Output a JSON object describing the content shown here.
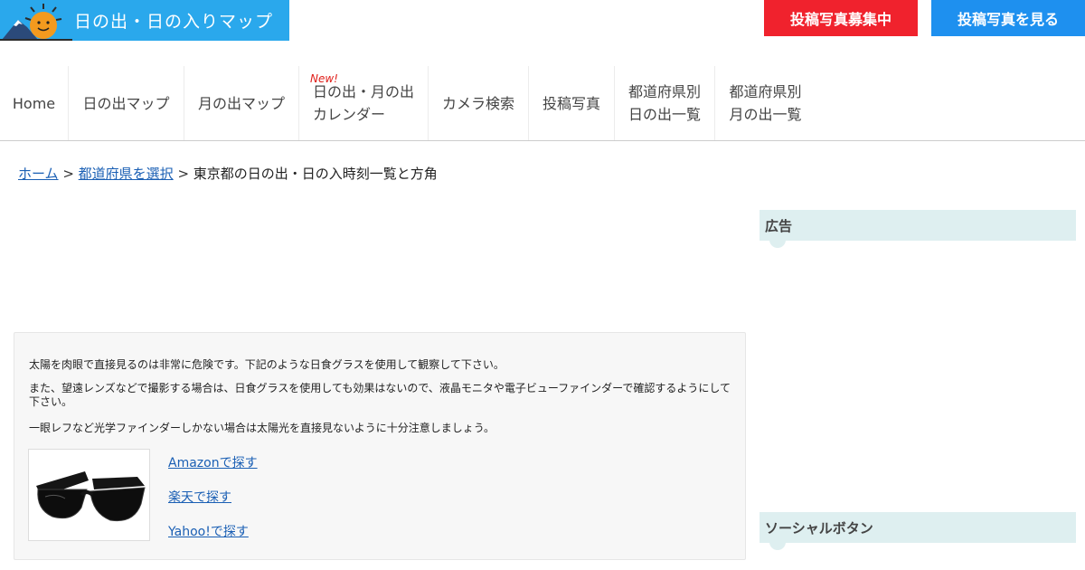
{
  "header": {
    "logo_text": "日の出・日の入りマップ",
    "recruit_button": "投稿写真募集中",
    "view_photos_button": "投稿写真を見る"
  },
  "nav": {
    "home": "Home",
    "sunrise_map": "日の出マップ",
    "moonrise_map": "月の出マップ",
    "calendar_new": "New!",
    "calendar_line1": "日の出・月の出",
    "calendar_line2": "カレンダー",
    "camera_search": "カメラ検索",
    "posted_photos": "投稿写真",
    "pref_sunrise_line1": "都道府県別",
    "pref_sunrise_line2": "日の出一覧",
    "pref_moonrise_line1": "都道府県別",
    "pref_moonrise_line2": "月の出一覧"
  },
  "breadcrumb": {
    "home": "ホーム",
    "sep1": " > ",
    "select_pref": "都道府県を選択",
    "sep2": " > ",
    "current": "東京都の日の出・日の入時刻一覧と方角"
  },
  "notice": {
    "line1": "太陽を肉眼で直接見るのは非常に危険です。下記のような日食グラスを使用して観察して下さい。",
    "line2": "また、望遠レンズなどで撮影する場合は、日食グラスを使用しても効果はないので、液晶モニタや電子ビューファインダーで確認するようにして下さい。",
    "line3": "一眼レフなど光学ファインダーしかない場合は太陽光を直接見ないように十分注意しましょう。",
    "amazon_link": "Amazonで探す",
    "rakuten_link": "楽天で探す",
    "yahoo_link": "Yahoo!で探す"
  },
  "sidebar": {
    "ad_heading": "広告",
    "social_heading": "ソーシャルボタン"
  },
  "colors": {
    "logo_bg": "#2aa8ec",
    "recruit_bg": "#f0222d",
    "view_bg": "#1e90ef",
    "link": "#1a5fb4",
    "side_head_bg": "#deeff0"
  }
}
